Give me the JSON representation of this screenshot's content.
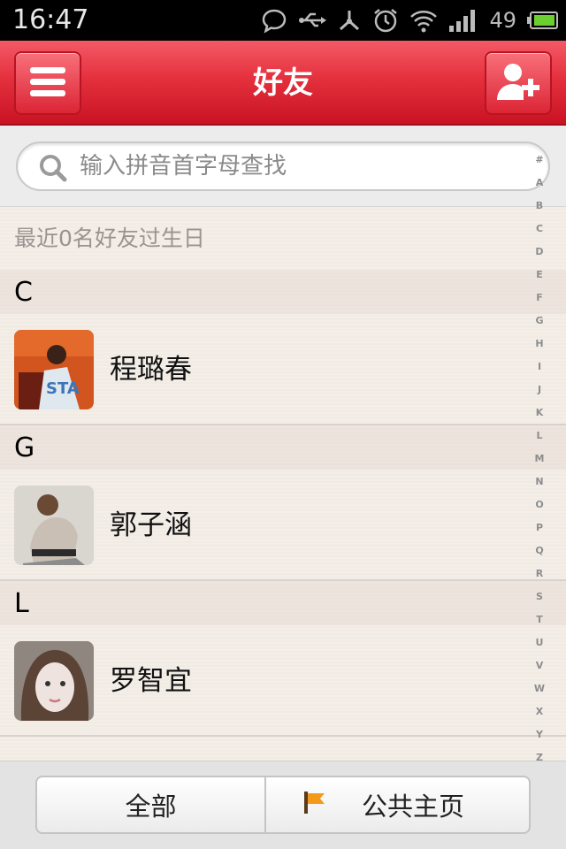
{
  "status_bar": {
    "time": "16:47",
    "battery": "49"
  },
  "header": {
    "title": "好友"
  },
  "search": {
    "placeholder": "输入拼音首字母查找"
  },
  "birthday_notice": "最近0名好友过生日",
  "sections": [
    {
      "letter": "C",
      "friend": "程璐春"
    },
    {
      "letter": "G",
      "friend": "郭子涵"
    },
    {
      "letter": "L",
      "friend": "罗智宜"
    }
  ],
  "alphabet": [
    "#",
    "A",
    "B",
    "C",
    "D",
    "E",
    "F",
    "G",
    "H",
    "I",
    "J",
    "K",
    "L",
    "M",
    "N",
    "O",
    "P",
    "Q",
    "R",
    "S",
    "T",
    "U",
    "V",
    "W",
    "X",
    "Y",
    "Z"
  ],
  "bottom_tabs": {
    "all": "全部",
    "public": "公共主页"
  },
  "colors": {
    "header_red": "#e5303e",
    "flag_orange": "#f39a1b"
  },
  "icons": [
    "chat-icon",
    "usb-icon",
    "share-icon",
    "alarm-icon",
    "wifi-icon",
    "signal-icon",
    "battery-icon",
    "menu-icon",
    "add-friend-icon",
    "search-icon",
    "flag-icon"
  ]
}
